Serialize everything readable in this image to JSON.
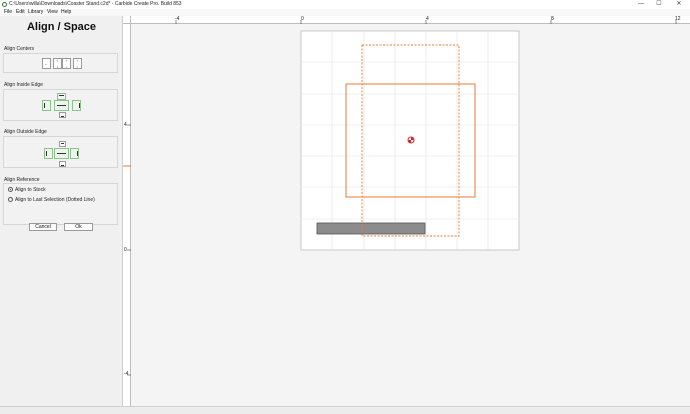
{
  "window": {
    "title": "C:\\Users\\willa\\Downloads\\Coaster Stand.c2d* - Carbide Create Pro. Build 853",
    "minimize": "—",
    "maximize": "☐",
    "close": "✕"
  },
  "menu": {
    "file": "File",
    "edit": "Edit",
    "library": "Library",
    "view": "View",
    "help": "Help"
  },
  "panel": {
    "title": "Align / Space",
    "align_centers_label": "Align Centers",
    "align_inside_label": "Align Inside Edge",
    "align_outside_label": "Align Outside Edge",
    "align_reference_label": "Align Reference",
    "reference_stock": "Align to Stock",
    "reference_last": "Align to Last Selection (Dotted Line)",
    "cancel_label": "Cancel",
    "ok_label": "Ok"
  },
  "ruler": {
    "top_ticks": [
      "-4",
      "0",
      "4",
      "8",
      "12"
    ],
    "left_ticks": [
      "4",
      "0",
      "-4"
    ]
  },
  "colors": {
    "selection": "#e87a32",
    "shape_fill": "#8c8c8c",
    "grid": "#dedede",
    "origin": "#d62828"
  }
}
